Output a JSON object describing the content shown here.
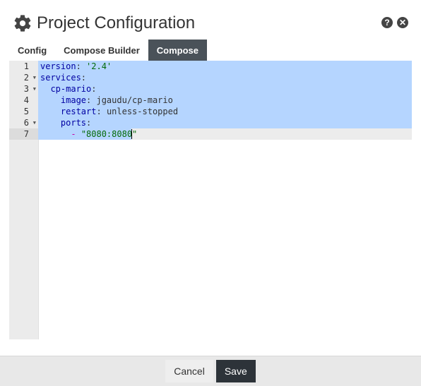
{
  "header": {
    "title": "Project Configuration",
    "help_icon": "question-icon",
    "close_icon": "close-icon",
    "settings_icon": "gear-icon"
  },
  "tabs": [
    {
      "label": "Config",
      "active": false
    },
    {
      "label": "Compose Builder",
      "active": false
    },
    {
      "label": "Compose",
      "active": true
    }
  ],
  "editor": {
    "lines": [
      {
        "number": "1",
        "foldable": false
      },
      {
        "number": "2",
        "foldable": true
      },
      {
        "number": "3",
        "foldable": true
      },
      {
        "number": "4",
        "foldable": false
      },
      {
        "number": "5",
        "foldable": false
      },
      {
        "number": "6",
        "foldable": true
      },
      {
        "number": "7",
        "foldable": false
      }
    ],
    "code": {
      "l1_key": "version",
      "l1_colon": ": ",
      "l1_val": "'2.4'",
      "l2_key": "services",
      "l2_colon": ":",
      "l3_key": "cp-mario",
      "l3_colon": ":",
      "l4_key": "image",
      "l4_colon": ": ",
      "l4_val": "jgaudu/cp-mario",
      "l5_key": "restart",
      "l5_colon": ": ",
      "l5_val": "unless-stopped",
      "l6_key": "ports",
      "l6_colon": ":",
      "l7_dash": "- ",
      "l7_val": "\"8080:8080\""
    }
  },
  "footer": {
    "cancel_label": "Cancel",
    "save_label": "Save"
  },
  "colors": {
    "tab_active_bg": "#4a5259",
    "selection": "#b5d5ff",
    "save_button_bg": "#2d3339",
    "yaml_key": "#0000a2",
    "yaml_string": "#036a07"
  }
}
